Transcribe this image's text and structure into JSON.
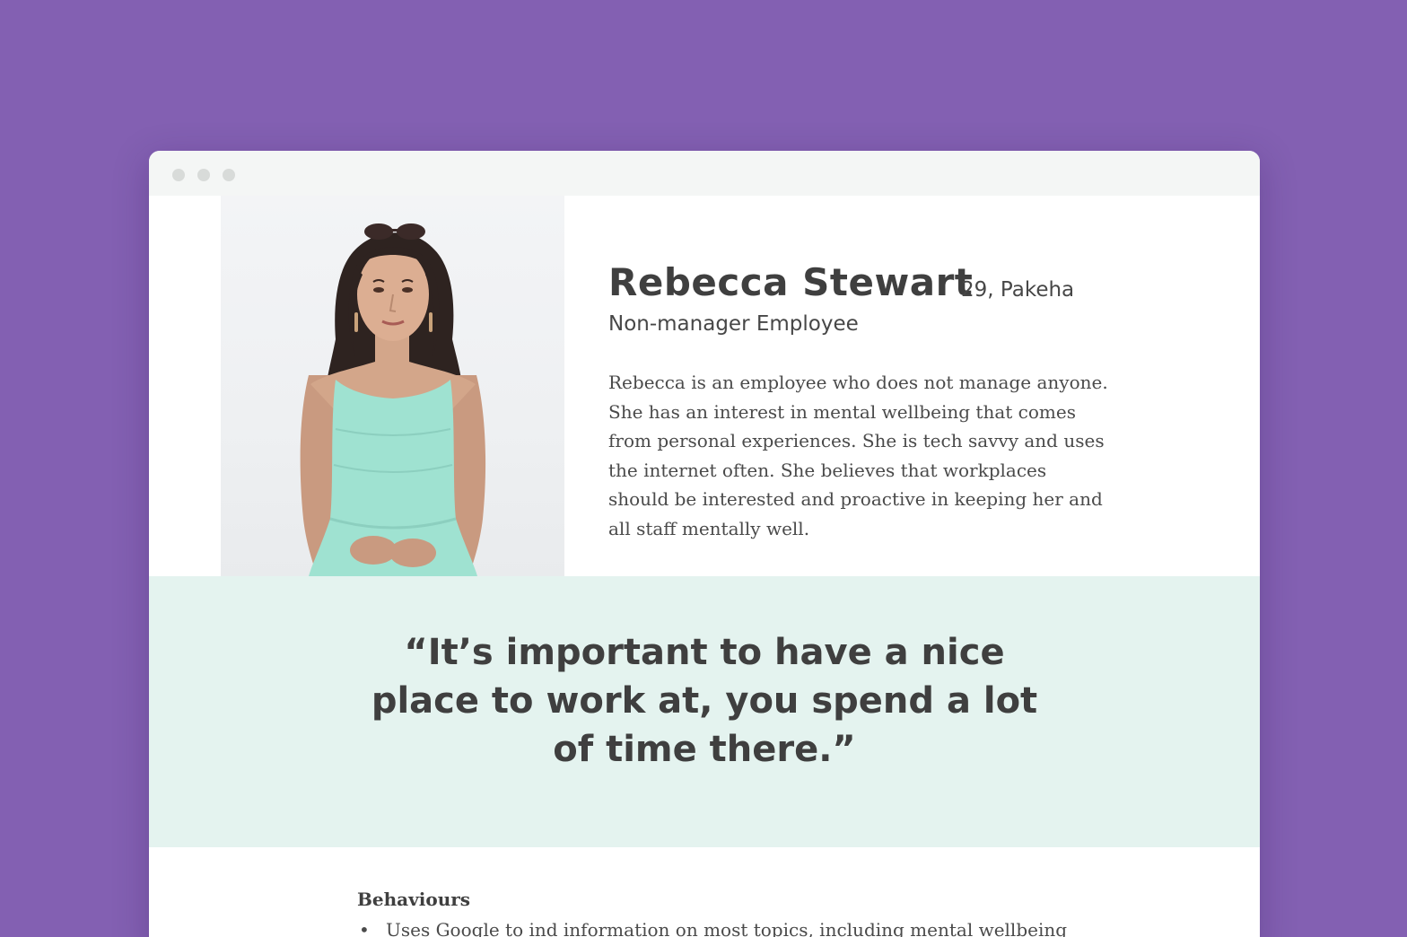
{
  "colors": {
    "background": "#8360b2",
    "window": "#ffffff",
    "titlebar": "#f4f6f5",
    "quote_band": "#e4f3ef",
    "text_dark": "#3f3f3f"
  },
  "window": {
    "controls": [
      "window-dot-icon",
      "window-dot-icon",
      "window-dot-icon"
    ]
  },
  "profile": {
    "photo_icon": "person-portrait-photo",
    "name": "Rebecca Stewart",
    "meta": "29, Pakeha",
    "role": "Non-manager Employee",
    "bio": "Rebecca is an employee who does not manage anyone. She has an interest in mental wellbeing that comes from personal experiences. She is tech savvy and uses the internet often. She believes that workplaces should be interested and proactive in keeping her and all staff mentally well."
  },
  "quote": {
    "text": "“It’s important to have a nice place to work at, you spend a lot of time there.”"
  },
  "behaviours": {
    "heading": "Behaviours",
    "bullet": "•",
    "items": [
      "Uses Google to ind information on most topics, including mental wellbeing"
    ]
  }
}
